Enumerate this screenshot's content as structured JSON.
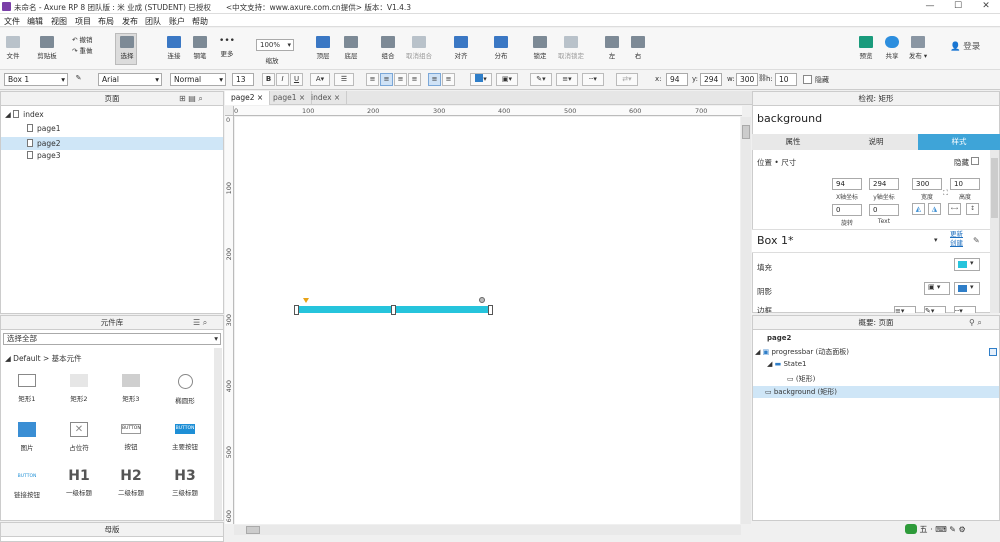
{
  "window": {
    "title": "未命名 - Axure RP 8 团队版 : 米 业成 (STUDENT) 已授权　　<中文支持：www.axure.com.cn提供> 版本：V1.4.3",
    "minimize": "—",
    "maximize": "☐",
    "close": "✕"
  },
  "menu": [
    "文件",
    "编辑",
    "视图",
    "项目",
    "布局",
    "发布",
    "团队",
    "账户",
    "帮助"
  ],
  "toolbar": {
    "file": "文件",
    "clipboard": "剪贴板",
    "undo": "撤销",
    "redo": "重做",
    "select": "选择",
    "connect": "连接",
    "pen": "钢笔",
    "more": "更多",
    "zoom_value": "100%",
    "zoom": "缩放",
    "top": "顶层",
    "bottom": "底层",
    "group": "组合",
    "ungroup": "取消组合",
    "align": "对齐",
    "distribute": "分布",
    "lock": "锁定",
    "unlock": "取消锁定",
    "left": "左",
    "right": "右",
    "preview": "预览",
    "share": "共享",
    "publish": "发布",
    "login": "登录"
  },
  "format": {
    "style": "Box 1",
    "font": "Arial",
    "weight": "Normal",
    "size": "13",
    "x_label": "x:",
    "x": "94",
    "y_label": "y:",
    "y": "294",
    "w_label": "w:",
    "w": "300",
    "h_label": "h:",
    "h": "10",
    "hidden": "隐藏"
  },
  "pages_panel": {
    "title": "页面",
    "root": "index",
    "pages": [
      "page1",
      "page2",
      "page3"
    ],
    "selected": "page2"
  },
  "library_panel": {
    "title": "元件库",
    "filter": "选择全部",
    "group": "Default > 基本元件",
    "widgets": [
      "矩形1",
      "矩形2",
      "矩形3",
      "椭圆形",
      "图片",
      "占位符",
      "按钮",
      "主要按钮",
      "链接按钮",
      "一级标题",
      "二级标题",
      "三级标题"
    ],
    "button_text": "BUTTON",
    "h1": "H1",
    "h2": "H2",
    "h3": "H3"
  },
  "masters_panel": {
    "title": "母版"
  },
  "tabs": [
    "page2",
    "page1",
    "index"
  ],
  "ruler": {
    "h": [
      "0",
      "100",
      "200",
      "300",
      "400",
      "500",
      "600",
      "700"
    ],
    "v": [
      "0",
      "100",
      "200",
      "300",
      "400",
      "500",
      "600"
    ]
  },
  "canvas": {
    "bar_color": "#26c4dc"
  },
  "inspector": {
    "header": "检视: 矩形",
    "name": "background",
    "tabs": [
      "属性",
      "说明",
      "样式"
    ],
    "active_tab": "样式",
    "section": "位置 • 尺寸",
    "hidden": "隐藏",
    "x": "94",
    "y": "294",
    "w": "300",
    "h": "10",
    "x_label": "X轴坐标",
    "y_label": "y轴坐标",
    "w_label": "宽度",
    "h_label": "高度",
    "rotation": "0",
    "text_rotation": "0",
    "rotation_label": "旋转",
    "text_label": "Text",
    "style_name": "Box 1*",
    "update_link": "更新",
    "create_link": "创建",
    "fill": "填充",
    "shadow": "阴影",
    "border": "边框",
    "fill_color": "#26c4dc"
  },
  "outline": {
    "title": "概要: 页面",
    "page": "page2",
    "items": [
      "progressbar (动态面板)",
      "State1",
      "(矩形)",
      "background (矩形)"
    ]
  },
  "statusbar": {
    "ime": "五",
    "punct": "·",
    "tools": "⌨ ✎ ⚙"
  }
}
